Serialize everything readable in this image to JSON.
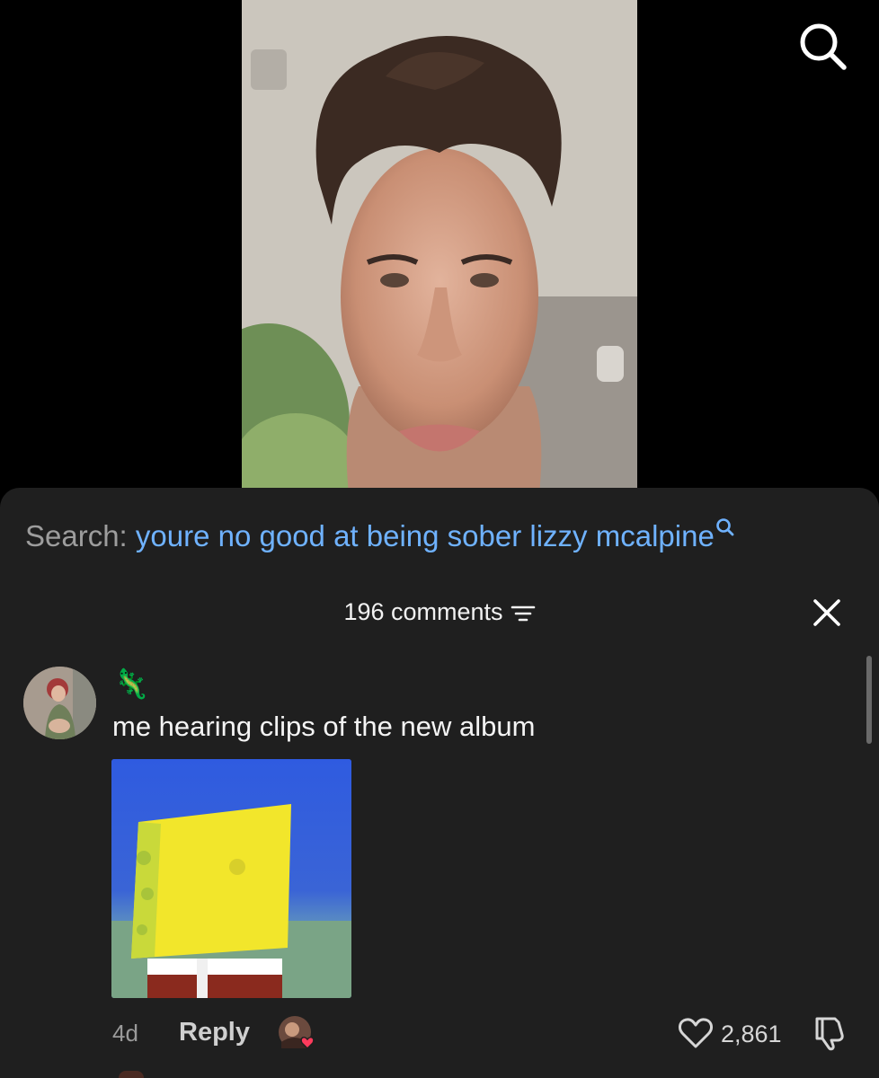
{
  "top_bar": {
    "search_icon": "search-icon"
  },
  "video": {
    "content": "video-frame"
  },
  "search_suggestion": {
    "label": "Search:",
    "query": "youre no good at being sober lizzy mcalpine",
    "icon": "search-mini-icon",
    "colors": {
      "label": "#9d9d9d",
      "query": "#6fb2ff"
    }
  },
  "comments_panel": {
    "count_label": "196 comments",
    "filter_icon": "filter-icon",
    "close_icon": "close-icon",
    "background": "#1f1f1f"
  },
  "comment": {
    "username": "🦎",
    "text": "me hearing clips of the new album",
    "sticker": "spongebob-sticker",
    "timestamp": "4d",
    "reply_label": "Reply",
    "creator_liked": true,
    "likes": "2,861",
    "icons": {
      "like": "heart-icon",
      "dislike": "dislike-icon"
    }
  }
}
